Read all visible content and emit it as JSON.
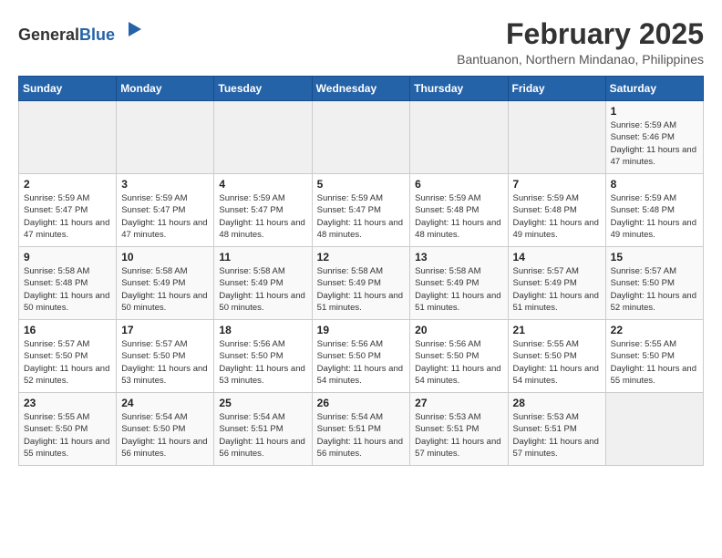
{
  "header": {
    "logo": {
      "general": "General",
      "blue": "Blue"
    },
    "title": "February 2025",
    "location": "Bantuanon, Northern Mindanao, Philippines"
  },
  "calendar": {
    "days_of_week": [
      "Sunday",
      "Monday",
      "Tuesday",
      "Wednesday",
      "Thursday",
      "Friday",
      "Saturday"
    ],
    "weeks": [
      [
        {
          "day": "",
          "info": ""
        },
        {
          "day": "",
          "info": ""
        },
        {
          "day": "",
          "info": ""
        },
        {
          "day": "",
          "info": ""
        },
        {
          "day": "",
          "info": ""
        },
        {
          "day": "",
          "info": ""
        },
        {
          "day": "1",
          "info": "Sunrise: 5:59 AM\nSunset: 5:46 PM\nDaylight: 11 hours and 47 minutes."
        }
      ],
      [
        {
          "day": "2",
          "info": "Sunrise: 5:59 AM\nSunset: 5:47 PM\nDaylight: 11 hours and 47 minutes."
        },
        {
          "day": "3",
          "info": "Sunrise: 5:59 AM\nSunset: 5:47 PM\nDaylight: 11 hours and 47 minutes."
        },
        {
          "day": "4",
          "info": "Sunrise: 5:59 AM\nSunset: 5:47 PM\nDaylight: 11 hours and 48 minutes."
        },
        {
          "day": "5",
          "info": "Sunrise: 5:59 AM\nSunset: 5:47 PM\nDaylight: 11 hours and 48 minutes."
        },
        {
          "day": "6",
          "info": "Sunrise: 5:59 AM\nSunset: 5:48 PM\nDaylight: 11 hours and 48 minutes."
        },
        {
          "day": "7",
          "info": "Sunrise: 5:59 AM\nSunset: 5:48 PM\nDaylight: 11 hours and 49 minutes."
        },
        {
          "day": "8",
          "info": "Sunrise: 5:59 AM\nSunset: 5:48 PM\nDaylight: 11 hours and 49 minutes."
        }
      ],
      [
        {
          "day": "9",
          "info": "Sunrise: 5:58 AM\nSunset: 5:48 PM\nDaylight: 11 hours and 50 minutes."
        },
        {
          "day": "10",
          "info": "Sunrise: 5:58 AM\nSunset: 5:49 PM\nDaylight: 11 hours and 50 minutes."
        },
        {
          "day": "11",
          "info": "Sunrise: 5:58 AM\nSunset: 5:49 PM\nDaylight: 11 hours and 50 minutes."
        },
        {
          "day": "12",
          "info": "Sunrise: 5:58 AM\nSunset: 5:49 PM\nDaylight: 11 hours and 51 minutes."
        },
        {
          "day": "13",
          "info": "Sunrise: 5:58 AM\nSunset: 5:49 PM\nDaylight: 11 hours and 51 minutes."
        },
        {
          "day": "14",
          "info": "Sunrise: 5:57 AM\nSunset: 5:49 PM\nDaylight: 11 hours and 51 minutes."
        },
        {
          "day": "15",
          "info": "Sunrise: 5:57 AM\nSunset: 5:50 PM\nDaylight: 11 hours and 52 minutes."
        }
      ],
      [
        {
          "day": "16",
          "info": "Sunrise: 5:57 AM\nSunset: 5:50 PM\nDaylight: 11 hours and 52 minutes."
        },
        {
          "day": "17",
          "info": "Sunrise: 5:57 AM\nSunset: 5:50 PM\nDaylight: 11 hours and 53 minutes."
        },
        {
          "day": "18",
          "info": "Sunrise: 5:56 AM\nSunset: 5:50 PM\nDaylight: 11 hours and 53 minutes."
        },
        {
          "day": "19",
          "info": "Sunrise: 5:56 AM\nSunset: 5:50 PM\nDaylight: 11 hours and 54 minutes."
        },
        {
          "day": "20",
          "info": "Sunrise: 5:56 AM\nSunset: 5:50 PM\nDaylight: 11 hours and 54 minutes."
        },
        {
          "day": "21",
          "info": "Sunrise: 5:55 AM\nSunset: 5:50 PM\nDaylight: 11 hours and 54 minutes."
        },
        {
          "day": "22",
          "info": "Sunrise: 5:55 AM\nSunset: 5:50 PM\nDaylight: 11 hours and 55 minutes."
        }
      ],
      [
        {
          "day": "23",
          "info": "Sunrise: 5:55 AM\nSunset: 5:50 PM\nDaylight: 11 hours and 55 minutes."
        },
        {
          "day": "24",
          "info": "Sunrise: 5:54 AM\nSunset: 5:50 PM\nDaylight: 11 hours and 56 minutes."
        },
        {
          "day": "25",
          "info": "Sunrise: 5:54 AM\nSunset: 5:51 PM\nDaylight: 11 hours and 56 minutes."
        },
        {
          "day": "26",
          "info": "Sunrise: 5:54 AM\nSunset: 5:51 PM\nDaylight: 11 hours and 56 minutes."
        },
        {
          "day": "27",
          "info": "Sunrise: 5:53 AM\nSunset: 5:51 PM\nDaylight: 11 hours and 57 minutes."
        },
        {
          "day": "28",
          "info": "Sunrise: 5:53 AM\nSunset: 5:51 PM\nDaylight: 11 hours and 57 minutes."
        },
        {
          "day": "",
          "info": ""
        }
      ]
    ]
  }
}
